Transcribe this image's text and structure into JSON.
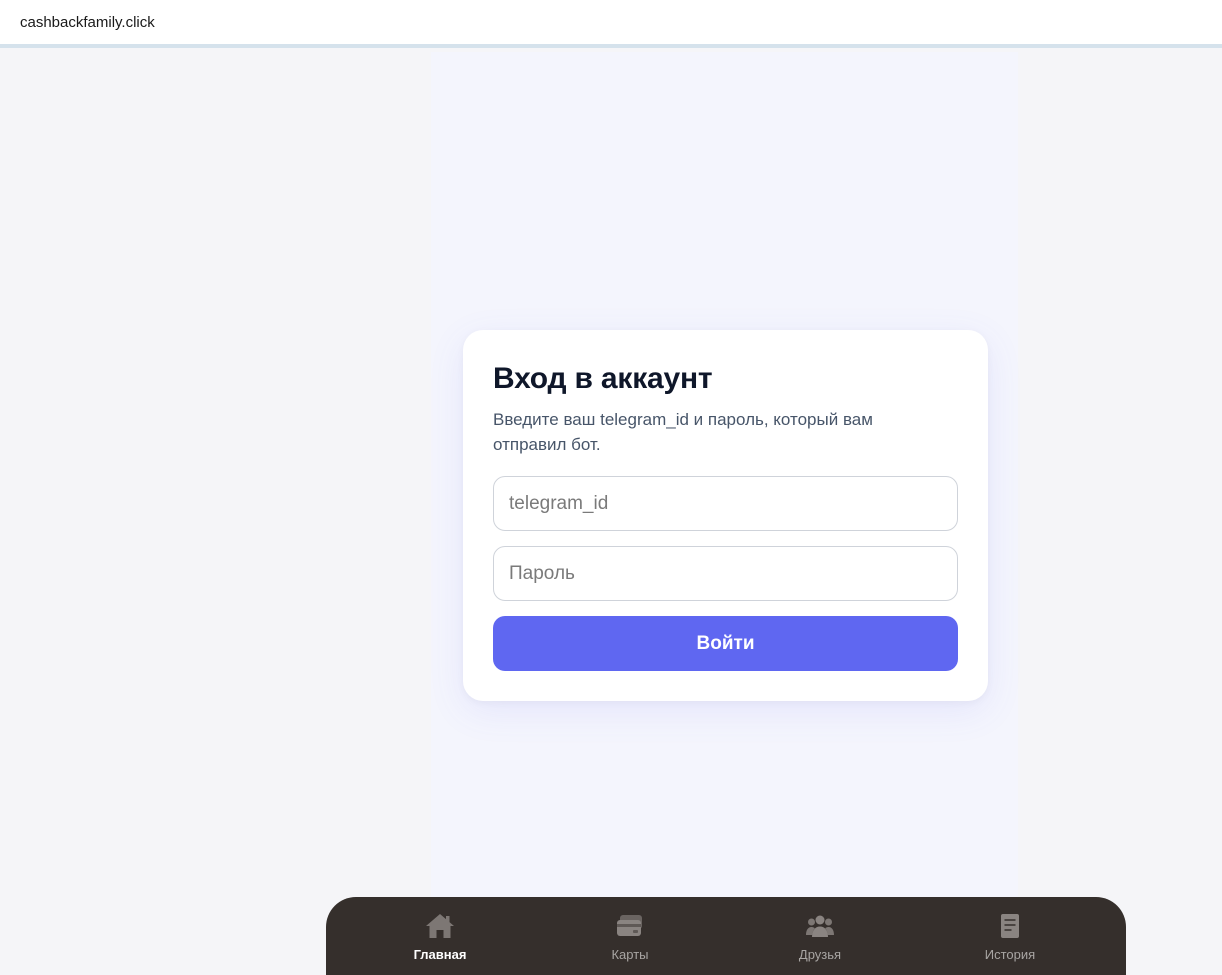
{
  "browser": {
    "url": "cashbackfamily.click"
  },
  "login": {
    "title": "Вход в аккаунт",
    "subtitle": "Введите ваш telegram_id и пароль, который вам отправил бот.",
    "telegram_id_placeholder": "telegram_id",
    "password_placeholder": "Пароль",
    "submit_label": "Войти"
  },
  "nav": {
    "items": [
      {
        "label": "Главная",
        "icon": "home-icon",
        "active": true
      },
      {
        "label": "Карты",
        "icon": "cards-icon",
        "active": false
      },
      {
        "label": "Друзья",
        "icon": "friends-icon",
        "active": false
      },
      {
        "label": "История",
        "icon": "history-icon",
        "active": false
      }
    ]
  },
  "colors": {
    "accent": "#5f67f1",
    "nav_background": "#352f2c",
    "title": "#0f172a"
  }
}
